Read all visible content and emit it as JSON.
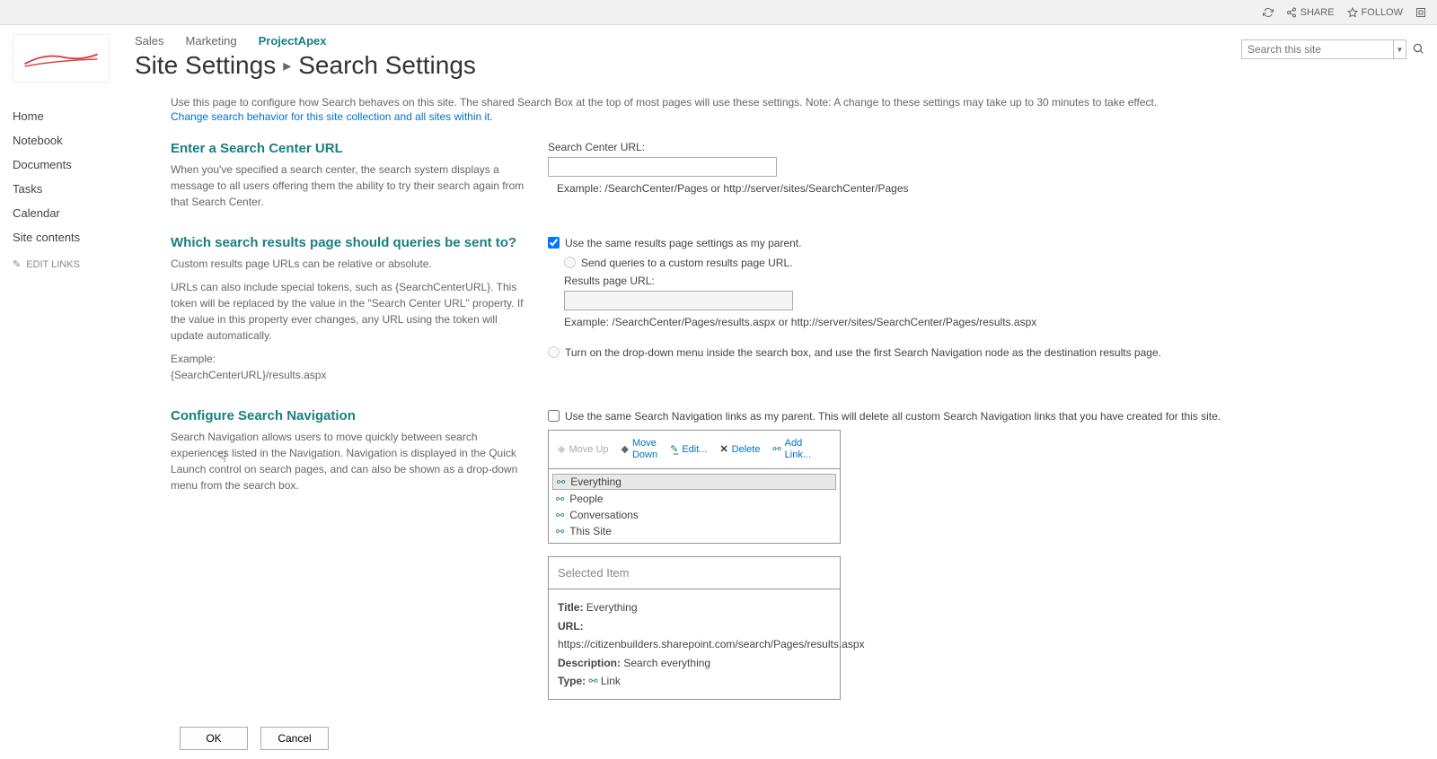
{
  "ribbon": {
    "share": "SHARE",
    "follow": "FOLLOW"
  },
  "topnav": {
    "items": [
      "Sales",
      "Marketing",
      "ProjectApex"
    ],
    "active": 2
  },
  "title": {
    "crumb": "Site Settings",
    "page": "Search Settings"
  },
  "search_top": {
    "placeholder": "Search this site"
  },
  "quick_launch": {
    "items": [
      "Home",
      "Notebook",
      "Documents",
      "Tasks",
      "Calendar",
      "Site contents"
    ],
    "edit": "EDIT LINKS"
  },
  "intro": {
    "line1": "Use this page to configure how Search behaves on this site. The shared Search Box at the top of most pages will use these settings. Note: A change to these settings may take up to 30 minutes to take effect.",
    "link": "Change search behavior for this site collection and all sites within it."
  },
  "sec1": {
    "heading": "Enter a Search Center URL",
    "desc": "When you've specified a search center, the search system displays a message to all users offering them the ability to try their search again from that Search Center.",
    "label": "Search Center URL:",
    "example": "Example: /SearchCenter/Pages or http://server/sites/SearchCenter/Pages"
  },
  "sec2": {
    "heading": "Which search results page should queries be sent to?",
    "desc1": "Custom results page URLs can be relative or absolute.",
    "desc2": "URLs can also include special tokens, such as {SearchCenterURL}. This token will be replaced by the value in the \"Search Center URL\" property. If the value in this property ever changes, any URL using the token will update automatically.",
    "desc3a": "Example:",
    "desc3b": "{SearchCenterURL}/results.aspx",
    "cb_parent": "Use the same results page settings as my parent.",
    "radio_custom": "Send queries to a custom results page URL.",
    "results_label": "Results page URL:",
    "results_example": "Example: /SearchCenter/Pages/results.aspx or http://server/sites/SearchCenter/Pages/results.aspx",
    "radio_dropdown": "Turn on the drop-down menu inside the search box, and use the first Search Navigation node as the destination results page."
  },
  "sec3": {
    "heading": "Configure Search Navigation",
    "desc": "Search Navigation allows users to move quickly between search experiences listed in the Navigation. Navigation is displayed in the Quick Launch control on search pages, and can also be shown as a drop-down menu from the search box.",
    "cb_same": "Use the same Search Navigation links as my parent. This will delete all custom Search Navigation links that you have created for this site.",
    "toolbar": {
      "moveup": "Move Up",
      "movedown": "Move\nDown",
      "edit": "Edit...",
      "delete": "Delete",
      "addlink": "Add\nLink..."
    },
    "items": [
      "Everything",
      "People",
      "Conversations",
      "This Site"
    ],
    "selected_header": "Selected Item",
    "sel_title_lbl": "Title:",
    "sel_title_val": "Everything",
    "sel_url_lbl": "URL:",
    "sel_url_val": "https://citizenbuilders.sharepoint.com/search/Pages/results.aspx",
    "sel_desc_lbl": "Description:",
    "sel_desc_val": "Search everything",
    "sel_type_lbl": "Type:",
    "sel_type_val": "Link"
  },
  "buttons": {
    "ok": "OK",
    "cancel": "Cancel"
  }
}
